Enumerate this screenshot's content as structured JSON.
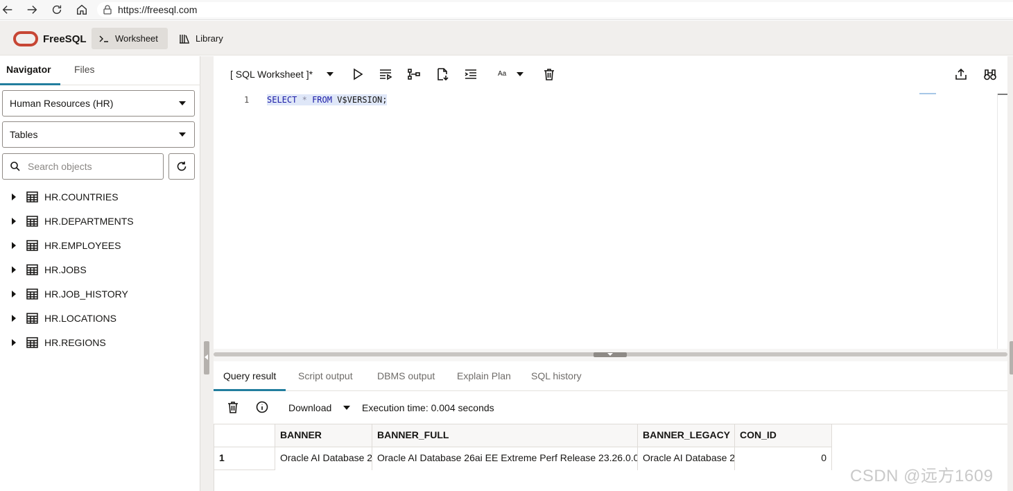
{
  "browser": {
    "url": "https://freesql.com"
  },
  "header": {
    "brand": "FreeSQL",
    "tabs": [
      {
        "label": "Worksheet",
        "active": true
      },
      {
        "label": "Library",
        "active": false
      }
    ],
    "accent_color": "#c74634"
  },
  "navigator": {
    "tabs": [
      {
        "label": "Navigator",
        "active": true
      },
      {
        "label": "Files",
        "active": false
      }
    ],
    "schema_select": "Human Resources (HR)",
    "object_type_select": "Tables",
    "search_placeholder": "Search objects",
    "tables": [
      "HR.COUNTRIES",
      "HR.DEPARTMENTS",
      "HR.EMPLOYEES",
      "HR.JOBS",
      "HR.JOB_HISTORY",
      "HR.LOCATIONS",
      "HR.REGIONS"
    ]
  },
  "editor": {
    "title": "[ SQL Worksheet ]*",
    "font_label": "Aa",
    "lines": [
      {
        "number": "1",
        "text": "SELECT * FROM V$VERSION;"
      }
    ]
  },
  "results": {
    "tabs": [
      {
        "label": "Query result",
        "active": true
      },
      {
        "label": "Script output",
        "active": false
      },
      {
        "label": "DBMS output",
        "active": false
      },
      {
        "label": "Explain Plan",
        "active": false
      },
      {
        "label": "SQL history",
        "active": false
      }
    ],
    "download_label": "Download",
    "execution_time": "Execution time: 0.004 seconds",
    "columns": [
      "BANNER",
      "BANNER_FULL",
      "BANNER_LEGACY",
      "CON_ID"
    ],
    "rows": [
      {
        "row_num": "1",
        "cells": [
          "Oracle AI Database 2",
          "Oracle AI Database 26ai EE Extreme Perf Release 23.26.0.0.",
          "Oracle AI Database 2",
          "0"
        ]
      }
    ]
  },
  "watermark": "CSDN @远方1609"
}
